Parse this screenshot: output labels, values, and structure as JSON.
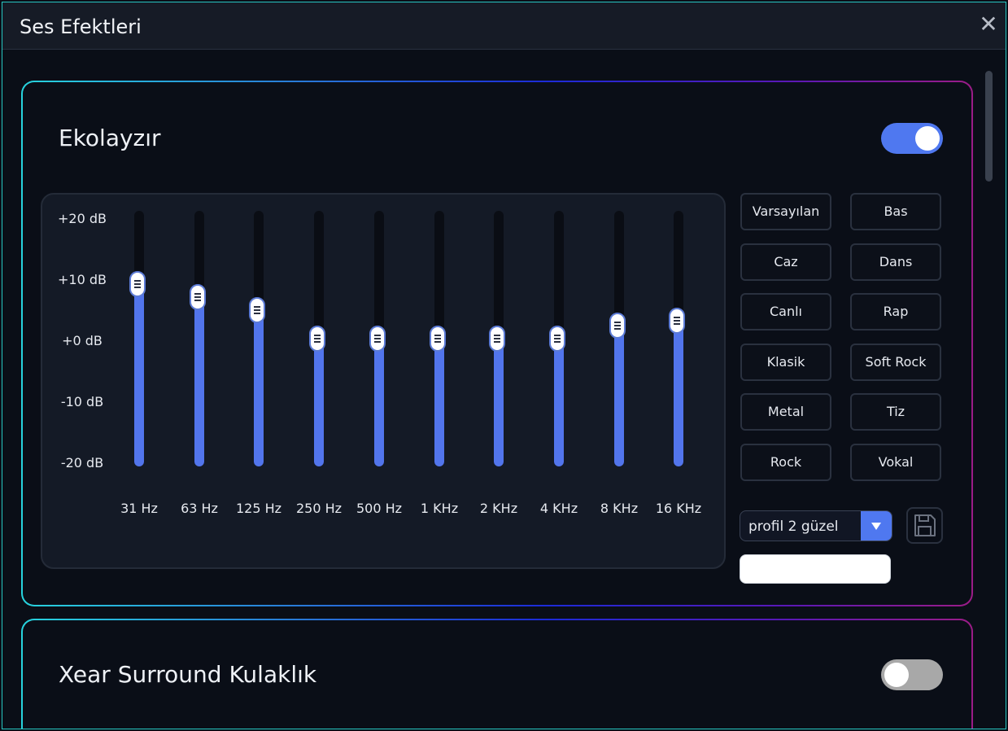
{
  "window": {
    "title": "Ses Efektleri",
    "close_glyph": "✕"
  },
  "equalizer": {
    "title": "Ekolayzır",
    "enabled": true,
    "db_labels": [
      "+20 dB",
      "+10 dB",
      "+0 dB",
      "-10 dB",
      "-20 dB"
    ],
    "db_range": [
      -20,
      20
    ],
    "bands": [
      {
        "label": "31 Hz",
        "gain_db": 8.5
      },
      {
        "label": "63 Hz",
        "gain_db": 6.5
      },
      {
        "label": "125 Hz",
        "gain_db": 4.5
      },
      {
        "label": "250 Hz",
        "gain_db": 0
      },
      {
        "label": "500 Hz",
        "gain_db": 0
      },
      {
        "label": "1 KHz",
        "gain_db": 0
      },
      {
        "label": "2 KHz",
        "gain_db": 0
      },
      {
        "label": "4 KHz",
        "gain_db": 0
      },
      {
        "label": "8 KHz",
        "gain_db": 2
      },
      {
        "label": "16 KHz",
        "gain_db": 2.8
      }
    ],
    "presets": [
      "Varsayılan",
      "Bas",
      "Caz",
      "Dans",
      "Canlı",
      "Rap",
      "Klasik",
      "Soft Rock",
      "Metal",
      "Tiz",
      "Rock",
      "Vokal"
    ],
    "profile": {
      "selected": "profil 2 güzel"
    },
    "profile_name_value": "",
    "save_icon": "floppy-disk-icon"
  },
  "surround": {
    "title": "Xear Surround Kulaklık",
    "enabled": false
  },
  "colors": {
    "accent": "#4f78f0",
    "fill": "#5275ec",
    "bg": "#0a0e17",
    "panel": "#141a26"
  }
}
